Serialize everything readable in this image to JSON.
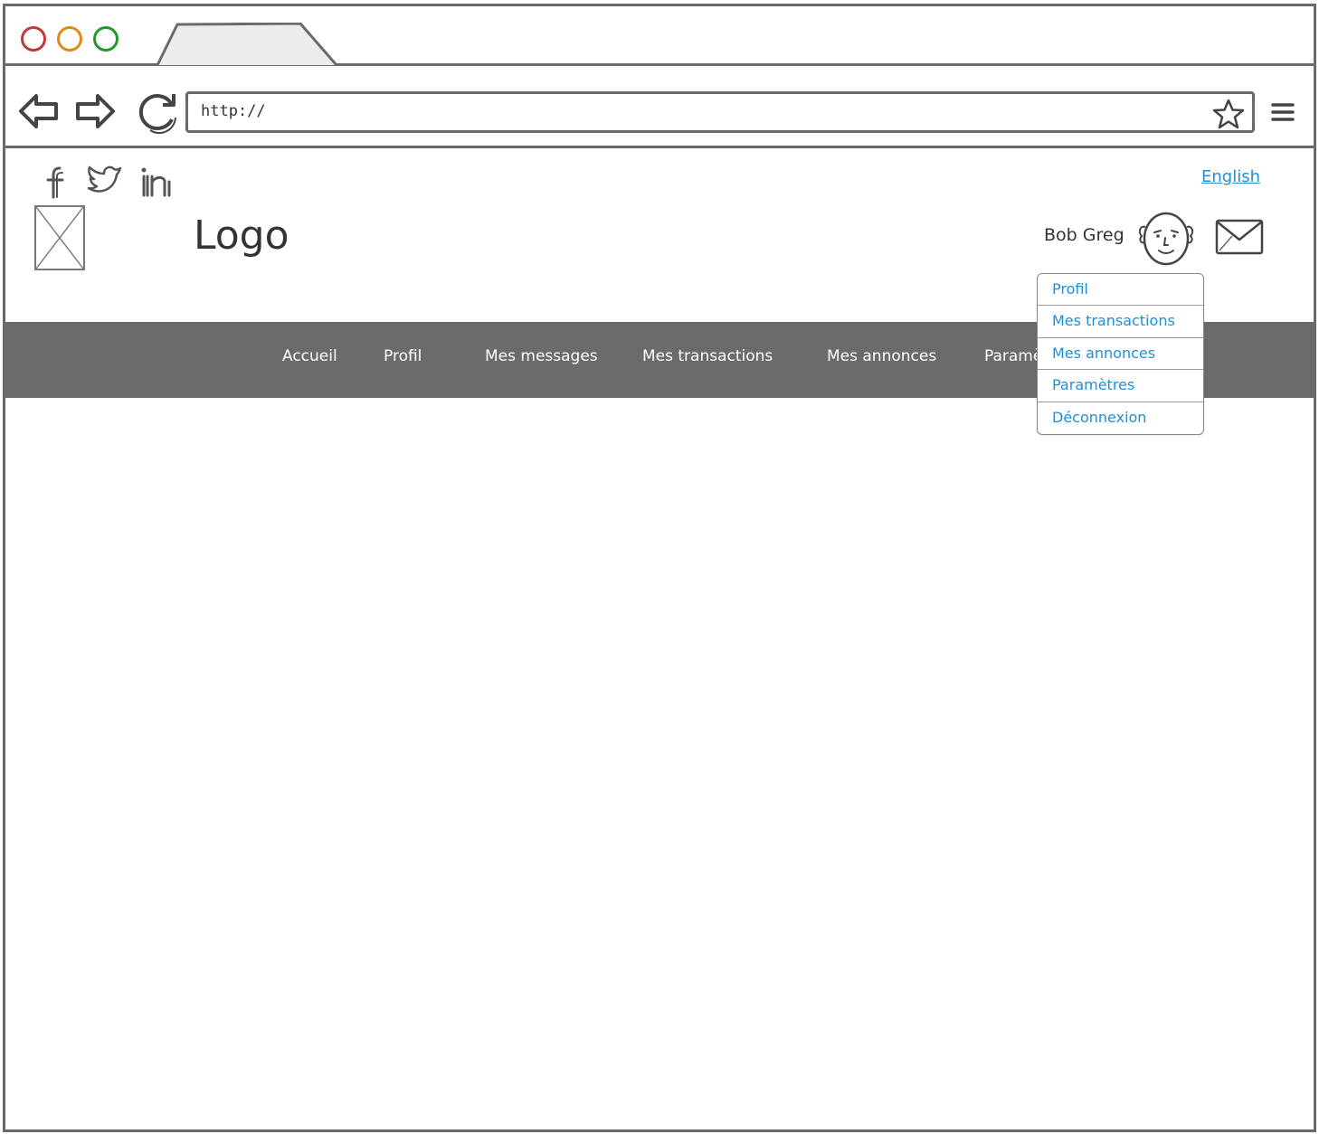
{
  "browser": {
    "url": "http://"
  },
  "header": {
    "language_link": "English",
    "logo_text": "Logo",
    "user_name": "Bob Greg"
  },
  "menu": {
    "items": [
      "Accueil",
      "Profil",
      "Mes messages",
      "Mes transactions",
      "Mes annonces",
      "Paramè"
    ]
  },
  "user_dropdown": {
    "items": [
      "Profil",
      "Mes transactions",
      "Mes annonces",
      "Paramètres",
      "Déconnexion"
    ]
  },
  "icons": {
    "social": [
      "facebook-icon",
      "twitter-icon",
      "linkedin-icon"
    ],
    "browser": [
      "back-arrow-icon",
      "forward-arrow-icon",
      "reload-icon",
      "star-icon",
      "hamburger-menu-icon"
    ],
    "user": [
      "avatar-face-icon",
      "mail-icon"
    ]
  },
  "colors": {
    "menubar_bg": "#6b6b6b",
    "link_blue": "#1f8fd6",
    "dot_red": "#c0393a",
    "dot_orange": "#e08a12",
    "dot_green": "#1f9a2a"
  }
}
